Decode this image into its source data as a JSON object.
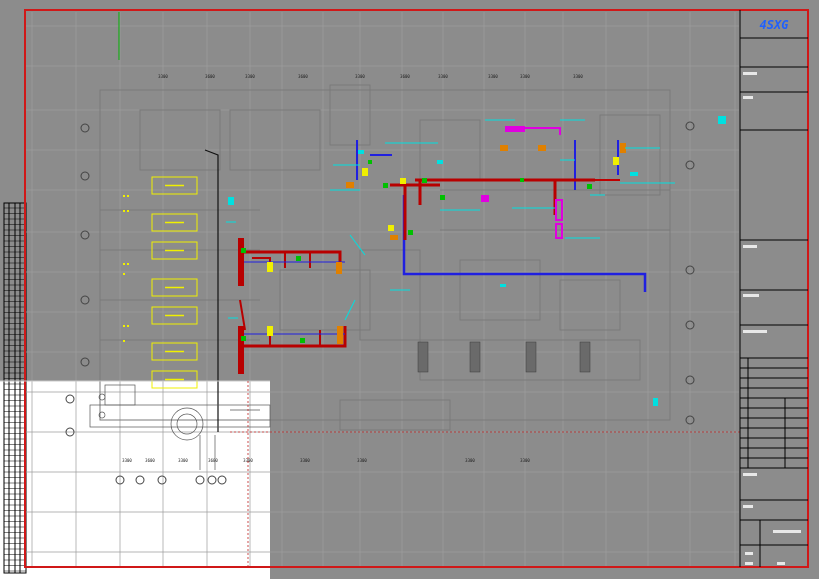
{
  "sheet": {
    "logo_text": "4SXG",
    "colors": {
      "background": "#8c8c8c",
      "border": "#d01818",
      "pipe_red": "#b80000",
      "pipe_blue": "#2020e0",
      "cyan": "#00e0e0",
      "magenta": "#e000e0",
      "yellow": "#f0f000",
      "green": "#00c000",
      "orange": "#e08000"
    }
  },
  "drawing": {
    "top_dims": [
      "3300",
      "3600",
      "3300",
      "3600",
      "3300",
      "3600",
      "3300",
      "3300",
      "3300",
      "3300"
    ],
    "bottom_dims": [
      "3300",
      "3600",
      "3300",
      "3600",
      "3300",
      "3300",
      "3300",
      "3300",
      "3300"
    ],
    "equipment_tags": [
      "",
      "",
      "",
      "",
      "",
      "",
      "",
      ""
    ]
  }
}
